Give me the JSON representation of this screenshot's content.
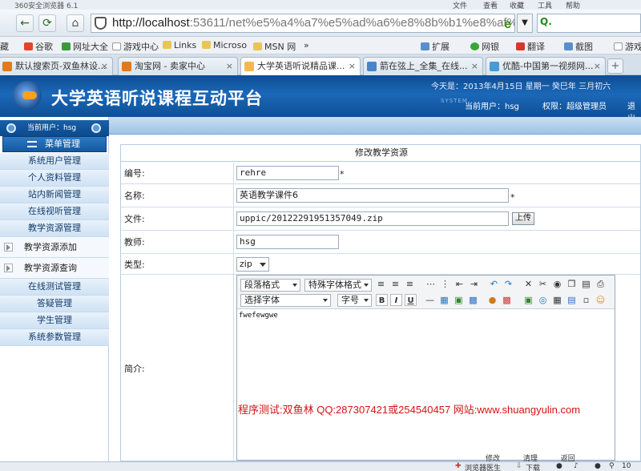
{
  "browser": {
    "app_title": "360安全浏览器 6.1",
    "menus": [
      "文件",
      "查看",
      "收藏",
      "工具",
      "帮助"
    ],
    "url_host": "http://localhost",
    "url_rest": ":53611/net%e5%a4%a7%e5%ad%a6%e8%8b%b1%e8%af%a",
    "favorites": [
      "藏",
      "谷歌",
      "网址大全",
      "游戏中心",
      "Links",
      "Microso",
      "MSN 网",
      "»",
      "扩展",
      "网银",
      "翻译",
      "截图",
      "游戏"
    ],
    "tabs": [
      {
        "label": "默认搜索页-双鱼林设..."
      },
      {
        "label": "淘宝网 - 卖家中心"
      },
      {
        "label": "大学英语听说精品课..."
      },
      {
        "label": "箭在弦上_全集_在线..."
      },
      {
        "label": "优酷-中国第一视频网..."
      }
    ],
    "status_left": "浏览器医生",
    "status_download": "下载",
    "status_zoom": "10"
  },
  "header": {
    "title": "大学英语听说课程互动平台",
    "date": "今天是：2013年4月15日  星期一  癸巳年  三月初六",
    "system_tag": "SYSTEM",
    "current_user": "当前用户：hsg",
    "role": "权限：超级管理员",
    "exit": "退出"
  },
  "sidebar": {
    "current_user": "当前用户：hsg",
    "menu_head": "菜单管理",
    "items": [
      {
        "label": "系统用户管理"
      },
      {
        "label": "个人资料管理"
      },
      {
        "label": "站内新闻管理"
      },
      {
        "label": "在线视听管理"
      },
      {
        "label": "教学资源管理"
      },
      {
        "label": "教学资源添加"
      },
      {
        "label": "教学资源查询"
      },
      {
        "label": "在线测试管理"
      },
      {
        "label": "答疑管理"
      },
      {
        "label": "学生管理"
      },
      {
        "label": "系统参数管理"
      }
    ]
  },
  "form": {
    "title": "修改教学资源",
    "labels": {
      "code": "编号:",
      "name": "名称:",
      "file": "文件:",
      "teacher": "教师:",
      "type": "类型:",
      "intro": "简介:"
    },
    "values": {
      "code": "rehre",
      "name": "英语教学课件6",
      "file": "uppic/20122291951357049.zip",
      "teacher": "hsg",
      "type": "zip"
    },
    "required_mark": "*",
    "upload_button": "上传",
    "editor": {
      "paragraph_format": "段落格式",
      "special_font": "特殊字体格式",
      "font": "选择字体",
      "font_size": "字号",
      "content": "fwefewgwe"
    },
    "watermark": "程序测试:双鱼林 QQ:287307421或254540457 网站:www.shuangyulin.com",
    "bottom_buttons": [
      "修改",
      "清理",
      "返回"
    ]
  }
}
